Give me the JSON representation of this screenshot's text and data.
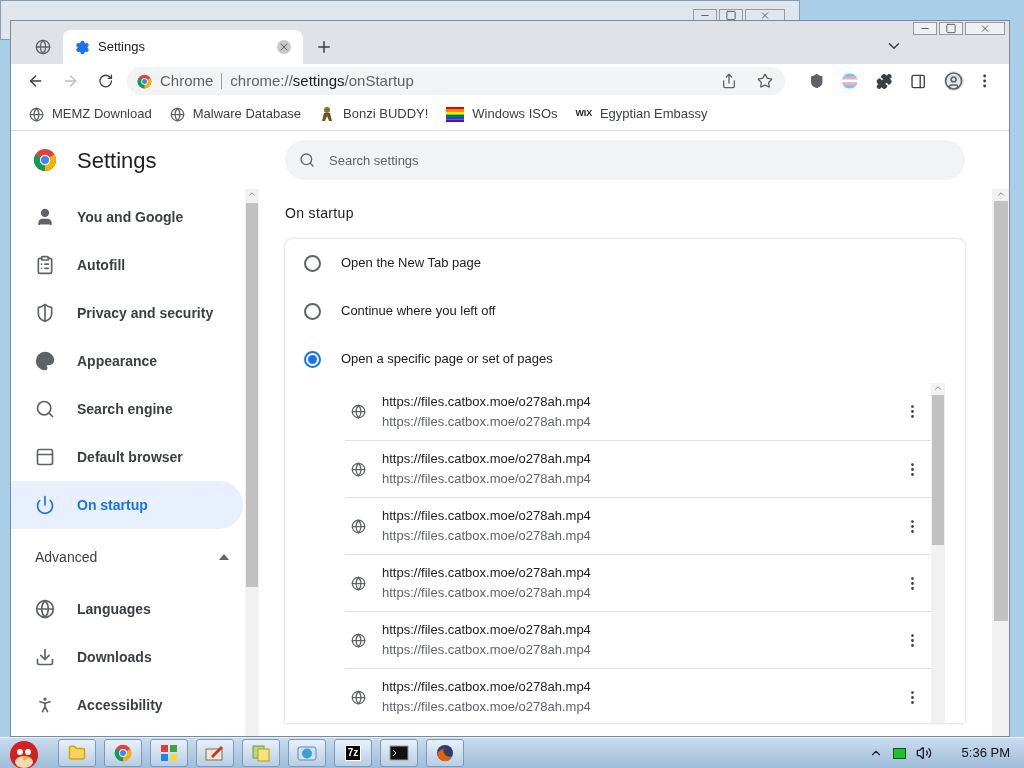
{
  "browser": {
    "tabs": [
      {
        "kind": "pinned",
        "selected": false
      },
      {
        "kind": "normal",
        "title": "Settings",
        "selected": true
      }
    ],
    "address": {
      "chip": "Chrome",
      "url_prefix": "chrome://",
      "url_host": "settings",
      "url_path": "/onStartup"
    },
    "bookmarks": [
      {
        "kind": "globe",
        "label": "MEMZ Download"
      },
      {
        "kind": "globe",
        "label": "Malware Database"
      },
      {
        "kind": "figure",
        "label": "Bonzi BUDDY!"
      },
      {
        "kind": "rainbow",
        "label": "Windows ISOs"
      },
      {
        "kind": "wix",
        "logo": "WIX",
        "label": "Egyptian Embassy"
      }
    ]
  },
  "settings": {
    "title": "Settings",
    "search": {
      "placeholder": "Search settings"
    },
    "nav": [
      {
        "kind": "person",
        "label": "You and Google",
        "selected": false
      },
      {
        "kind": "clipboard",
        "label": "Autofill",
        "selected": false
      },
      {
        "kind": "shield",
        "label": "Privacy and security",
        "selected": false
      },
      {
        "kind": "palette",
        "label": "Appearance",
        "selected": false
      },
      {
        "kind": "search",
        "label": "Search engine",
        "selected": false
      },
      {
        "kind": "browser",
        "label": "Default browser",
        "selected": false
      },
      {
        "kind": "power",
        "label": "On startup",
        "selected": true
      }
    ],
    "advanced": {
      "label": "Advanced",
      "expanded": true,
      "items": [
        {
          "kind": "globe",
          "label": "Languages",
          "selected": false
        },
        {
          "kind": "download",
          "label": "Downloads",
          "selected": false
        },
        {
          "kind": "accessibility",
          "label": "Accessibility",
          "selected": false
        }
      ]
    },
    "section": {
      "heading": "On startup",
      "options": [
        {
          "label": "Open the New Tab page",
          "selected": false
        },
        {
          "label": "Continue where you left off",
          "selected": false
        },
        {
          "label": "Open a specific page or set of pages",
          "selected": true
        }
      ],
      "pages": [
        {
          "title": "https://files.catbox.moe/o278ah.mp4",
          "url": "https://files.catbox.moe/o278ah.mp4"
        },
        {
          "title": "https://files.catbox.moe/o278ah.mp4",
          "url": "https://files.catbox.moe/o278ah.mp4"
        },
        {
          "title": "https://files.catbox.moe/o278ah.mp4",
          "url": "https://files.catbox.moe/o278ah.mp4"
        },
        {
          "title": "https://files.catbox.moe/o278ah.mp4",
          "url": "https://files.catbox.moe/o278ah.mp4"
        },
        {
          "title": "https://files.catbox.moe/o278ah.mp4",
          "url": "https://files.catbox.moe/o278ah.mp4"
        },
        {
          "title": "https://files.catbox.moe/o278ah.mp4",
          "url": "https://files.catbox.moe/o278ah.mp4"
        }
      ]
    }
  },
  "taskbar": {
    "apps": [
      {
        "kind": "folder"
      },
      {
        "kind": "chrome"
      },
      {
        "kind": "grid"
      },
      {
        "kind": "paint"
      },
      {
        "kind": "files"
      },
      {
        "kind": "network"
      },
      {
        "kind": "archive",
        "label": "7z"
      },
      {
        "kind": "console"
      },
      {
        "kind": "fox"
      }
    ],
    "clock": "5:36 PM"
  }
}
